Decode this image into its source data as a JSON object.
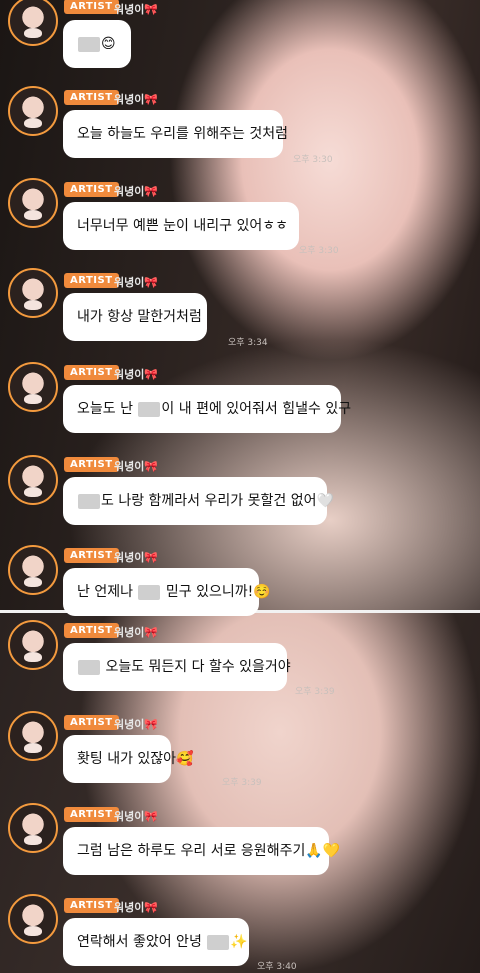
{
  "artist_tag": "ARTIST",
  "nickname": "워녕이",
  "bow": "🎀",
  "messages": [
    {
      "pre": "",
      "blur": true,
      "post": "😊",
      "time": ""
    },
    {
      "pre": "오늘 하늘도 우리를 위해주는 것처럼",
      "blur": false,
      "post": "",
      "time": "오후 3:30"
    },
    {
      "pre": "너무너무 예쁜 눈이 내리구 있어ㅎㅎ",
      "blur": false,
      "post": "",
      "time": "오후 3:30"
    },
    {
      "pre": "내가 항상 말한거처럼",
      "blur": false,
      "post": "",
      "time": "오후 3:34"
    },
    {
      "pre": "오늘도 난 ",
      "blur": true,
      "post": "이 내 편에 있어줘서 힘낼수 있구",
      "time": ""
    },
    {
      "pre": "",
      "blur": true,
      "post": "도 나랑 함께라서 우리가 못할건 없어🤍",
      "time": ""
    },
    {
      "pre": "난 언제나 ",
      "blur": true,
      "post": " 믿구 있으니까!☺️",
      "time": ""
    },
    {
      "pre": "",
      "blur": true,
      "post": " 오늘도 뭐든지 다 할수 있을거야",
      "time": "오후 3:39"
    },
    {
      "pre": "홧팅 내가 있잖아🥰",
      "blur": false,
      "post": "",
      "time": "오후 3:39"
    },
    {
      "pre": "그럼 남은 하루도 우리 서로 응원해주기🙏💛",
      "blur": false,
      "post": "",
      "time": ""
    },
    {
      "pre": "연락해서 좋았어 안녕 ",
      "blur": true,
      "post": "✨",
      "time": "오후 3:40"
    }
  ]
}
